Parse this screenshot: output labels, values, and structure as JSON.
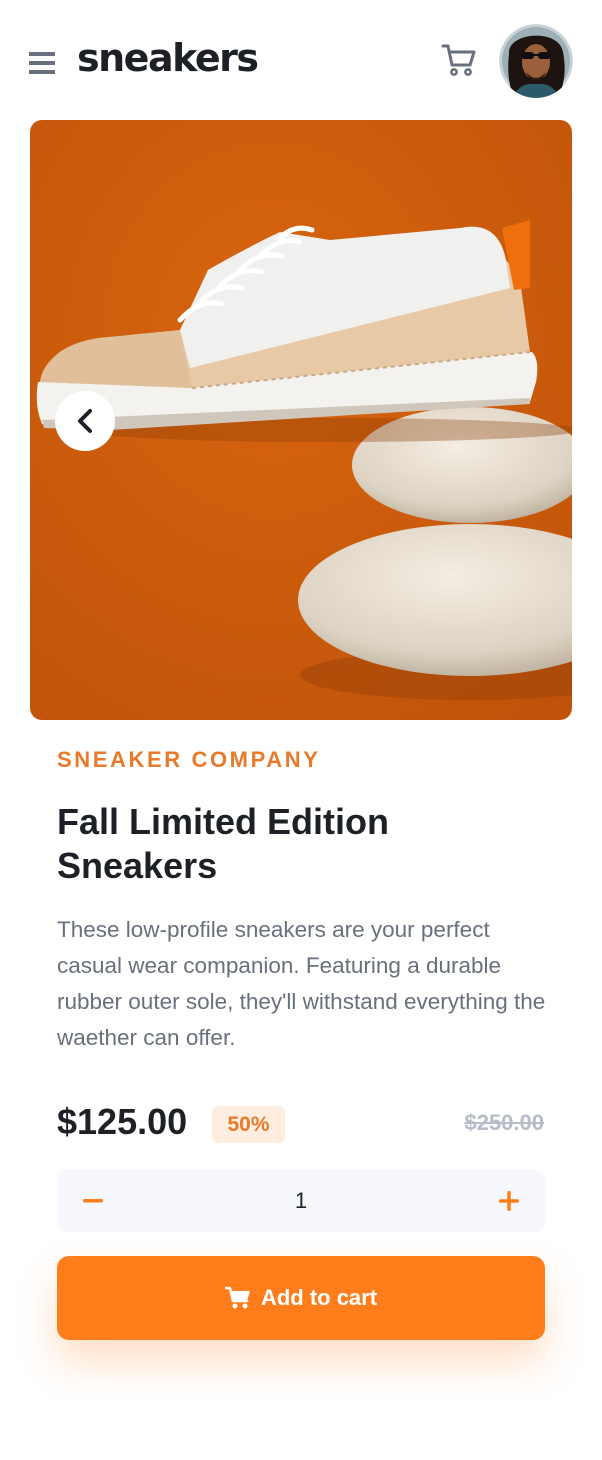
{
  "header": {
    "logo": "sneakers",
    "menu_icon": "hamburger-menu-icon",
    "cart_icon": "cart-icon",
    "avatar_icon": "avatar"
  },
  "gallery": {
    "prev_icon": "chevron-left-icon"
  },
  "product": {
    "company": "SNEAKER COMPANY",
    "title": "Fall Limited Edition Sneakers",
    "description": "These low-profile sneakers are your perfect casual wear companion. Featuring a durable rubber outer sole, they'll withstand everything the waether can offer.",
    "price": "$125.00",
    "discount": "50%",
    "original_price": "$250.00"
  },
  "quantity": {
    "value": "1",
    "minus_icon": "minus-icon",
    "plus_icon": "plus-icon"
  },
  "cta": {
    "label": "Add to cart",
    "icon": "cart-icon"
  },
  "colors": {
    "accent": "#ff7e1b",
    "accent_text": "#e87a2b",
    "accent_pale": "#ffede0",
    "dark": "#1d2026",
    "gray": "#69707d",
    "light_gray": "#b6bcc8",
    "qty_bg": "#f6f8fd"
  }
}
